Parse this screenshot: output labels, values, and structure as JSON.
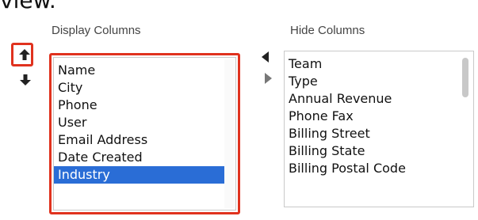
{
  "page": {
    "top_cut_word": "view."
  },
  "display_columns": {
    "header": "Display Columns",
    "items": [
      "Name",
      "City",
      "Phone",
      "User",
      "Email Address",
      "Date Created",
      "Industry"
    ],
    "selected": "Industry"
  },
  "hide_columns": {
    "header": "Hide Columns",
    "items": [
      "Team",
      "Type",
      "Annual Revenue",
      "Phone Fax",
      "Billing Street",
      "Billing State",
      "Billing Postal Code"
    ]
  },
  "icons": {
    "move_up": "arrow-up-icon",
    "move_down": "arrow-down-icon",
    "move_to_display": "triangle-left-icon",
    "move_to_hide": "triangle-right-icon"
  },
  "colors": {
    "highlight": "#e0321e",
    "selection": "#2a6dd6"
  }
}
